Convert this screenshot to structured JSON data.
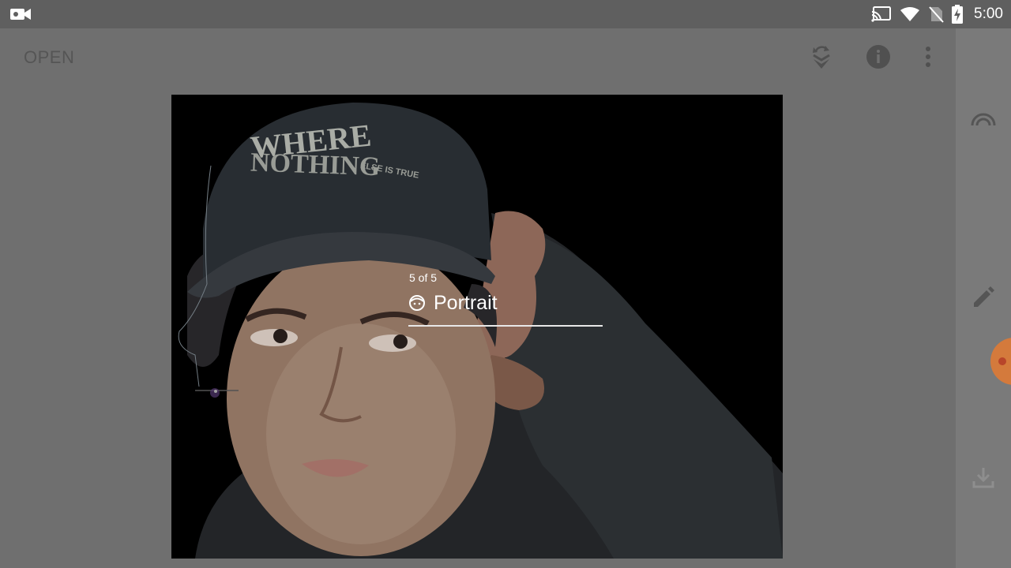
{
  "status_bar": {
    "time": "5:00",
    "icons": [
      "screen-record-icon",
      "cast-icon",
      "wifi-icon",
      "no-sim-icon",
      "battery-charging-icon"
    ]
  },
  "app_bar": {
    "open_label": "OPEN",
    "actions": [
      "layers-undo-icon",
      "info-icon",
      "more-vert-icon"
    ]
  },
  "right_rail": {
    "icons": [
      "looks-arc-icon",
      "edit-pencil-icon",
      "export-download-icon"
    ]
  },
  "canvas": {
    "cap_text_line1": "WHERE",
    "cap_text_line2": "NOTHING",
    "cap_text_line3": "ELSE IS TRUE"
  },
  "filter_picker": {
    "position_text": "5 of 5",
    "current_filter": "Portrait",
    "filter_icon": "face-icon"
  },
  "colors": {
    "status_bar": "#5f5f5f",
    "background": "#6f6f6f",
    "rail": "#7a7a7a",
    "fab": "#d47a3c"
  }
}
